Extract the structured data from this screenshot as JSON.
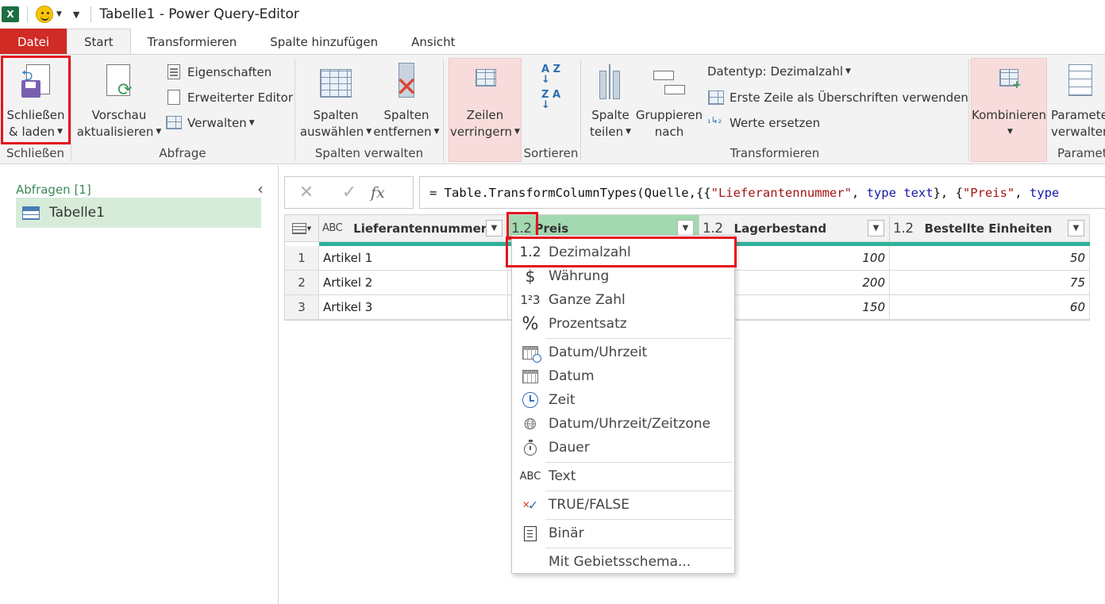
{
  "window": {
    "title": "Tabelle1 - Power Query-Editor",
    "app_icon": "X"
  },
  "tabs": [
    {
      "label": "Datei"
    },
    {
      "label": "Start"
    },
    {
      "label": "Transformieren"
    },
    {
      "label": "Spalte hinzufügen"
    },
    {
      "label": "Ansicht"
    }
  ],
  "ribbon": {
    "close_load": {
      "line1": "Schließen",
      "line2": "& laden"
    },
    "group_close": "Schließen",
    "refresh": {
      "line1": "Vorschau",
      "line2": "aktualisieren"
    },
    "properties": "Eigenschaften",
    "advanced_editor": "Erweiterter Editor",
    "manage": "Verwalten",
    "group_query": "Abfrage",
    "choose_cols": {
      "line1": "Spalten",
      "line2": "auswählen"
    },
    "remove_cols": {
      "line1": "Spalten",
      "line2": "entfernen"
    },
    "group_manage_cols": "Spalten verwalten",
    "reduce_rows": {
      "line1": "Zeilen",
      "line2": "verringern"
    },
    "sort_az": "A Z ↓",
    "sort_za": "Z A ↓",
    "group_sort": "Sortieren",
    "split_col": {
      "line1": "Spalte",
      "line2": "teilen"
    },
    "group_by": {
      "line1": "Gruppieren",
      "line2": "nach"
    },
    "data_type": "Datentyp: Dezimalzahl",
    "first_row_headers": "Erste Zeile als Überschriften verwenden",
    "replace_values": "Werte ersetzen",
    "group_transform": "Transformieren",
    "combine": "Kombinieren",
    "params": {
      "line1": "Paramete",
      "line2": "verwalten"
    },
    "group_params": "Paramete"
  },
  "left_pane": {
    "header": "Abfragen [1]",
    "queries": [
      "Tabelle1"
    ]
  },
  "formula_bar": {
    "cancel": "✕",
    "confirm": "✓",
    "fx": "fx",
    "formula_parts": [
      {
        "t": "= Table.TransformColumnTypes(Quelle,{{",
        "c": "plain"
      },
      {
        "t": "\"Lieferantennummer\"",
        "c": "str"
      },
      {
        "t": ", ",
        "c": "plain"
      },
      {
        "t": "type",
        "c": "kw"
      },
      {
        "t": " ",
        "c": "plain"
      },
      {
        "t": "text",
        "c": "kw"
      },
      {
        "t": "}, {",
        "c": "plain"
      },
      {
        "t": "\"Preis\"",
        "c": "str"
      },
      {
        "t": ", ",
        "c": "plain"
      },
      {
        "t": "type",
        "c": "kw"
      }
    ]
  },
  "grid": {
    "columns": [
      {
        "type_icon": "ABC",
        "name": "Lieferantennummer"
      },
      {
        "type_icon": "1.2",
        "name": "Preis"
      },
      {
        "type_icon": "1.2",
        "name": "Lagerbestand"
      },
      {
        "type_icon": "1.2",
        "name": "Bestellte Einheiten"
      }
    ],
    "rows": [
      {
        "n": "1",
        "c1": "Artikel 1",
        "c3": "100",
        "c4": "50"
      },
      {
        "n": "2",
        "c1": "Artikel 2",
        "c3": "200",
        "c4": "75"
      },
      {
        "n": "3",
        "c1": "Artikel 3",
        "c3": "150",
        "c4": "60"
      }
    ]
  },
  "type_menu": {
    "items": [
      {
        "icon": "1.2",
        "label": "Dezimalzahl"
      },
      {
        "icon": "$",
        "label": "Währung"
      },
      {
        "icon": "1²3",
        "label": "Ganze Zahl"
      },
      {
        "icon": "%",
        "label": "Prozentsatz"
      },
      {
        "icon": "datetime-icon",
        "label": "Datum/Uhrzeit"
      },
      {
        "icon": "calendar-icon",
        "label": "Datum"
      },
      {
        "icon": "clock-icon",
        "label": "Zeit"
      },
      {
        "icon": "globe-clock-icon",
        "label": "Datum/Uhrzeit/Zeitzone"
      },
      {
        "icon": "stopwatch-icon",
        "label": "Dauer"
      },
      {
        "icon": "ABC",
        "label": "Text"
      },
      {
        "icon": "true-false-icon",
        "label": "TRUE/FALSE"
      },
      {
        "icon": "binary-icon",
        "label": "Binär"
      },
      {
        "icon": "",
        "label": "Mit Gebietsschema..."
      }
    ]
  },
  "colors": {
    "accent_green": "#a3d9b1",
    "quality_bar": "#2cb299",
    "highlight_red": "#e3141d",
    "file_tab": "#d02b25"
  }
}
